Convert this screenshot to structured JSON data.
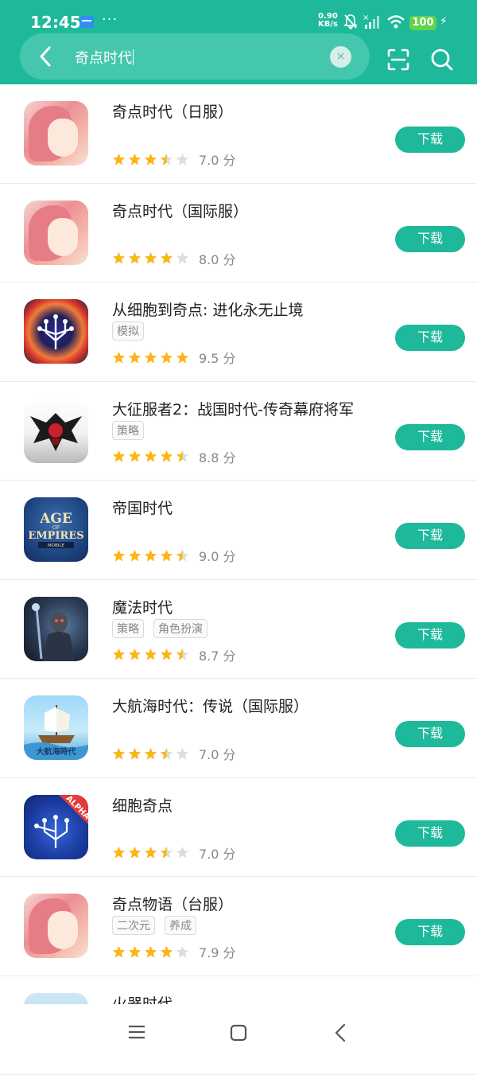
{
  "status_bar": {
    "time": "12:45",
    "dots": "···",
    "net_speed_value": "0.90",
    "net_speed_unit": "KB/s",
    "battery": "100",
    "icons": [
      "notification-icon",
      "mute-icon",
      "signal-icon",
      "wifi-icon",
      "battery-icon",
      "charging-icon"
    ]
  },
  "search": {
    "query": "奇点时代",
    "clear_icon": "×"
  },
  "download_label": "下载",
  "score_unit": "分",
  "colors": {
    "accent": "#1db99a",
    "star": "#fbb613",
    "star_empty": "#dddddd"
  },
  "results": [
    {
      "title": "奇点时代（日服）",
      "tags": [],
      "rating": 3.5,
      "score": "7.0",
      "icon": "anime-girl-icon"
    },
    {
      "title": "奇点时代（国际服）",
      "tags": [],
      "rating": 4,
      "score": "8.0",
      "icon": "anime-girl-icon"
    },
    {
      "title": "从细胞到奇点: 进化永无止境",
      "tags": [
        "模拟"
      ],
      "rating": 5,
      "score": "9.5",
      "icon": "cell-tree-icon"
    },
    {
      "title": "大征服者2：战国时代-传奇幕府将军",
      "tags": [
        "策略"
      ],
      "rating": 4.5,
      "score": "8.8",
      "icon": "samurai-helmet-icon"
    },
    {
      "title": "帝国时代",
      "tags": [],
      "rating": 4.5,
      "score": "9.0",
      "icon": "age-of-empires-icon",
      "icon_text": [
        "AGE",
        "OF",
        "EMPIRES",
        "MOBILE"
      ]
    },
    {
      "title": "魔法时代",
      "tags": [
        "策略",
        "角色扮演"
      ],
      "rating": 4.5,
      "score": "8.7",
      "icon": "dark-warrior-icon"
    },
    {
      "title": "大航海时代：传说（国际服）",
      "tags": [],
      "rating": 3.5,
      "score": "7.0",
      "icon": "sailing-ship-icon",
      "icon_text": [
        "大航海時代"
      ]
    },
    {
      "title": "细胞奇点",
      "tags": [],
      "rating": 3.5,
      "score": "7.0",
      "icon": "cell-alpha-icon",
      "icon_text": [
        "ALPHA"
      ]
    },
    {
      "title": "奇点物语（台服）",
      "tags": [
        "二次元",
        "养成"
      ],
      "rating": 4,
      "score": "7.9",
      "icon": "anime-girl-icon"
    },
    {
      "title": "火器时代",
      "tags": [],
      "rating": null,
      "score": "",
      "icon": "firearm-game-icon"
    }
  ],
  "nav": [
    "menu-icon",
    "home-icon",
    "back-icon"
  ]
}
